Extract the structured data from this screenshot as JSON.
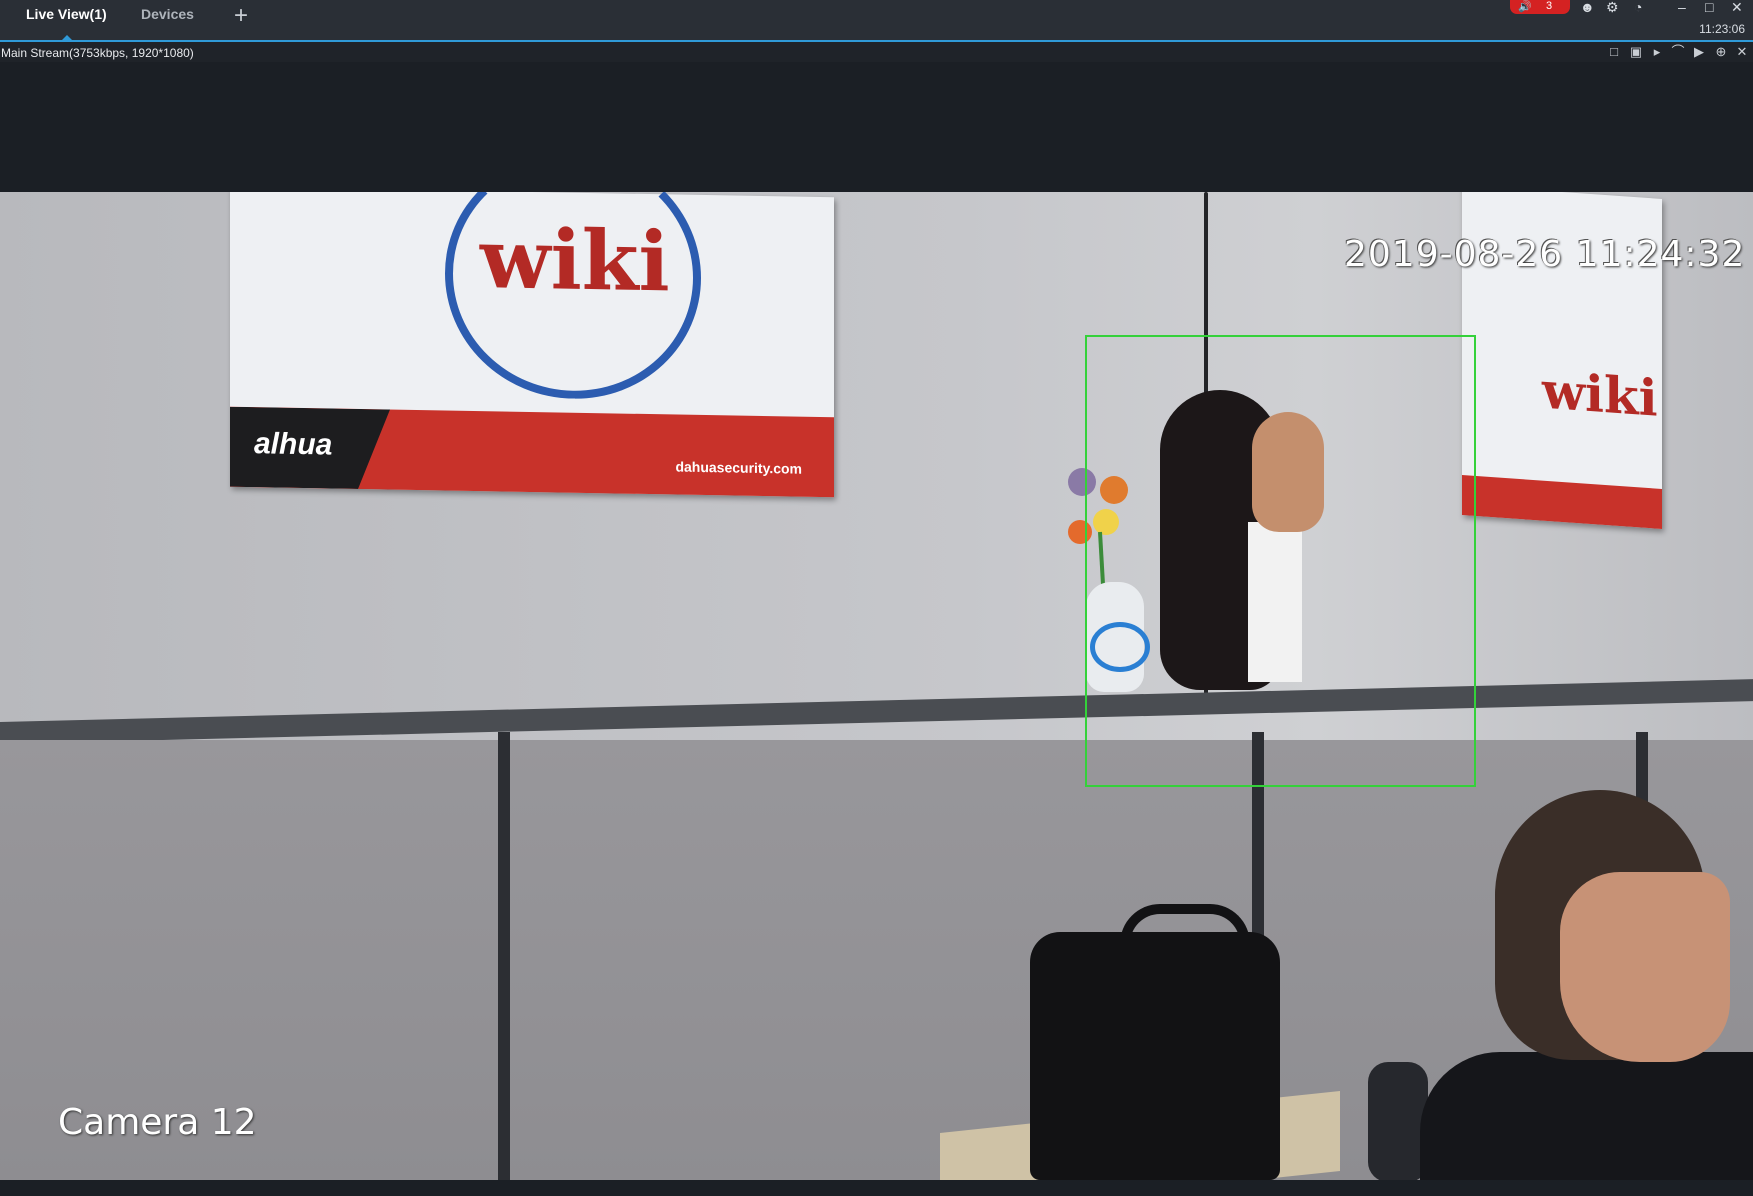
{
  "tabs": [
    {
      "label": "Live View(1)",
      "active": true
    },
    {
      "label": "Devices",
      "active": false
    }
  ],
  "add_tab_icon": "plus-icon",
  "status": {
    "alarm_count": "3",
    "clock": "11:23:06"
  },
  "stream": {
    "label": "Main Stream(3753kbps, 1920*1080)",
    "tools": [
      "record-icon",
      "snapshot-icon",
      "audio-icon",
      "microphone-icon",
      "playback-icon",
      "zoom-icon",
      "close-icon"
    ]
  },
  "video": {
    "osd_timestamp": "2019-08-26 11:24:32",
    "osd_camera_name": "Camera 12",
    "detection_color": "#34d13a"
  },
  "scene": {
    "poster_left_word": "wiki",
    "poster_left_brand": "alhua",
    "poster_left_url": "dahuasecurity.com",
    "poster_right_word": "wiki"
  },
  "colors": {
    "accent": "#2f9ad8",
    "alarm": "#d42222"
  }
}
